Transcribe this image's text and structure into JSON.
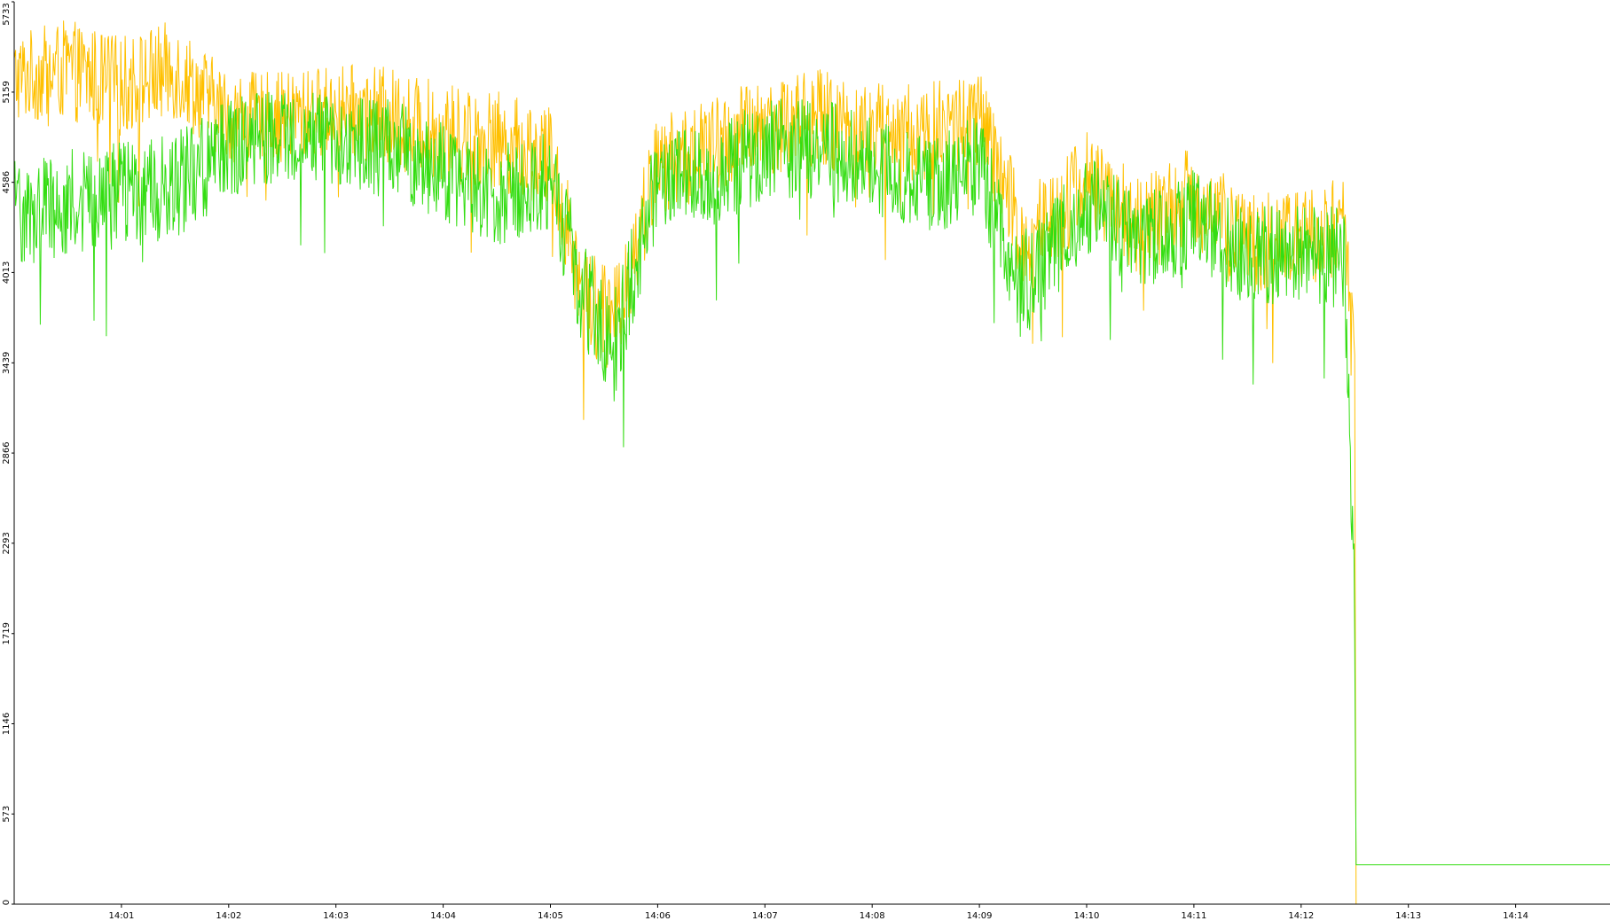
{
  "chart_data": {
    "type": "line",
    "title": "",
    "xlabel": "",
    "ylabel": "",
    "ylim": [
      0,
      5733
    ],
    "xlim_minutes": [
      0,
      14.88
    ],
    "y_ticks": [
      0,
      573,
      1146,
      1719,
      2293,
      2866,
      3439,
      4013,
      4586,
      5159,
      5733
    ],
    "y_tick_labels": [
      "0",
      "573",
      "1146",
      "1719",
      "2293",
      "2866",
      "3439",
      "4013",
      "4586",
      "5159",
      "5733"
    ],
    "x_ticks_minutes": [
      1,
      2,
      3,
      4,
      5,
      6,
      7,
      8,
      9,
      10,
      11,
      12,
      13,
      14
    ],
    "x_tick_labels": [
      "14:01",
      "14:02",
      "14:03",
      "14:04",
      "14:05",
      "14:06",
      "14:07",
      "14:08",
      "14:09",
      "14:10",
      "14:11",
      "14:12",
      "14:13",
      "14:14"
    ],
    "grid": false,
    "legend": "none",
    "series": [
      {
        "color": "#ffc000",
        "x_minutes": [
          0,
          0.5,
          1.0,
          1.5,
          2.0,
          2.5,
          3.0,
          3.5,
          4.0,
          4.5,
          5.0,
          5.3,
          5.6,
          6.0,
          6.5,
          7.0,
          7.5,
          8.0,
          8.5,
          9.0,
          9.4,
          10.0,
          10.5,
          11.0,
          11.5,
          12.0,
          12.4,
          12.5,
          12.51,
          14.88
        ],
        "y": [
          5250,
          5300,
          5200,
          5300,
          5000,
          5000,
          5050,
          5000,
          4900,
          4850,
          4750,
          3900,
          3700,
          4700,
          4800,
          4950,
          5000,
          4900,
          4900,
          5000,
          4200,
          4600,
          4300,
          4500,
          4200,
          4250,
          4300,
          3500,
          0,
          0
        ],
        "noise": [
          180,
          200,
          200,
          200,
          180,
          180,
          180,
          200,
          200,
          200,
          200,
          220,
          220,
          200,
          200,
          200,
          200,
          200,
          200,
          200,
          220,
          200,
          200,
          200,
          200,
          200,
          200,
          100,
          0,
          0
        ]
      },
      {
        "color": "#33dd11",
        "x_minutes": [
          0,
          0.5,
          1.0,
          1.5,
          2.0,
          2.5,
          3.0,
          3.5,
          4.0,
          4.5,
          5.0,
          5.3,
          5.6,
          6.0,
          6.5,
          7.0,
          7.5,
          8.0,
          8.5,
          9.0,
          9.4,
          10.0,
          10.5,
          11.0,
          11.5,
          12.0,
          12.4,
          12.5,
          12.51,
          14.88
        ],
        "y": [
          4400,
          4450,
          4500,
          4550,
          4800,
          4900,
          4850,
          4800,
          4650,
          4500,
          4600,
          3900,
          3550,
          4600,
          4600,
          4800,
          4800,
          4700,
          4550,
          4700,
          3900,
          4450,
          4200,
          4350,
          4100,
          4150,
          4100,
          1900,
          250,
          250
        ],
        "noise": [
          220,
          220,
          220,
          220,
          200,
          180,
          180,
          200,
          200,
          200,
          200,
          220,
          230,
          200,
          200,
          200,
          200,
          200,
          200,
          200,
          230,
          200,
          200,
          200,
          200,
          200,
          200,
          150,
          0,
          0
        ]
      }
    ]
  }
}
